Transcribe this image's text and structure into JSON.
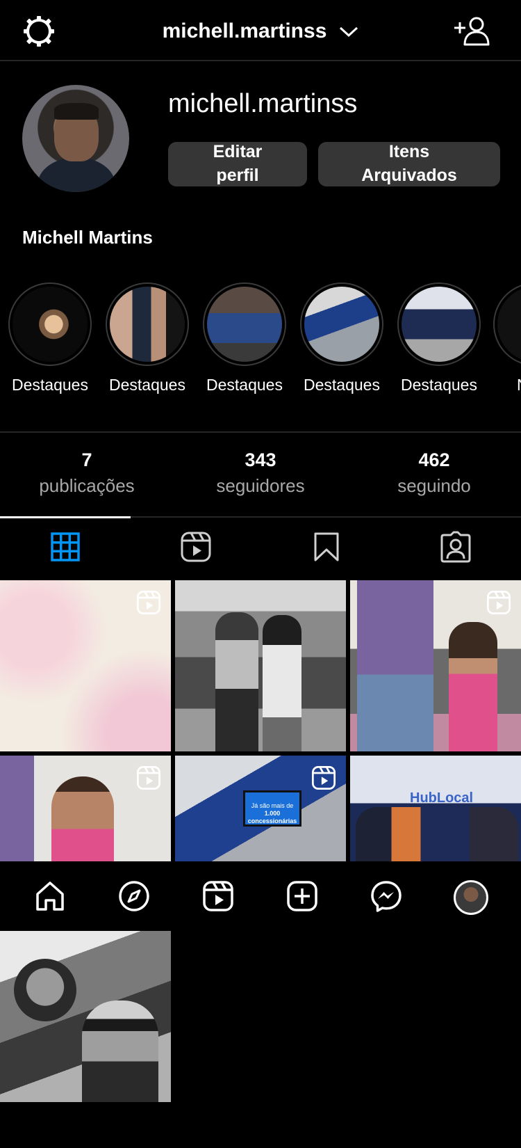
{
  "header": {
    "username": "michell.martinss",
    "icons": {
      "settings": "settings-icon",
      "dropdown": "chevron-down-icon",
      "add_user": "add-user-icon"
    }
  },
  "profile": {
    "username": "michell.martinss",
    "full_name": "Michell Martins",
    "edit_label_line1": "Editar",
    "edit_label_line2": "perfil",
    "archive_label_line1": "Itens",
    "archive_label_line2": "Arquivados"
  },
  "highlights": [
    {
      "label": "Destaques"
    },
    {
      "label": "Destaques"
    },
    {
      "label": "Destaques"
    },
    {
      "label": "Destaques"
    },
    {
      "label": "Destaques"
    },
    {
      "label": "N"
    }
  ],
  "stats": [
    {
      "value": "7",
      "label": "publicações"
    },
    {
      "value": "343",
      "label": "seguidores"
    },
    {
      "value": "462",
      "label": "seguindo"
    }
  ],
  "tabs": [
    {
      "name": "grid",
      "icon": "grid-icon",
      "active": true
    },
    {
      "name": "reels",
      "icon": "reels-icon",
      "active": false
    },
    {
      "name": "saved",
      "icon": "bookmark-icon",
      "active": false
    },
    {
      "name": "tagged",
      "icon": "tagged-icon",
      "active": false
    }
  ],
  "posts": [
    {
      "id": 1,
      "reel": true
    },
    {
      "id": 2,
      "reel": false
    },
    {
      "id": 3,
      "reel": true
    },
    {
      "id": 4,
      "reel": true
    },
    {
      "id": 5,
      "reel": true,
      "screen_line1": "Já são mais de",
      "screen_line2": "1.000 concessionárias"
    },
    {
      "id": 6,
      "reel": false,
      "banner": "HubLocal"
    },
    {
      "id": 7,
      "reel": false
    }
  ],
  "bottom_nav": [
    {
      "name": "home",
      "icon": "home-icon"
    },
    {
      "name": "explore",
      "icon": "compass-icon"
    },
    {
      "name": "reels",
      "icon": "reels-icon"
    },
    {
      "name": "create",
      "icon": "plus-square-icon"
    },
    {
      "name": "messenger",
      "icon": "messenger-icon"
    },
    {
      "name": "profile",
      "icon": "avatar"
    }
  ],
  "colors": {
    "background": "#000000",
    "button": "#363636",
    "accent": "#0095f6",
    "muted": "#a8a8a8"
  }
}
